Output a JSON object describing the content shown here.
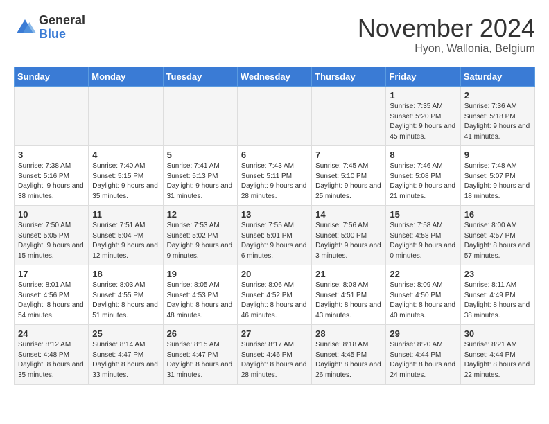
{
  "logo": {
    "general": "General",
    "blue": "Blue"
  },
  "title": "November 2024",
  "location": "Hyon, Wallonia, Belgium",
  "weekdays": [
    "Sunday",
    "Monday",
    "Tuesday",
    "Wednesday",
    "Thursday",
    "Friday",
    "Saturday"
  ],
  "weeks": [
    [
      {
        "day": "",
        "sunrise": "",
        "sunset": "",
        "daylight": ""
      },
      {
        "day": "",
        "sunrise": "",
        "sunset": "",
        "daylight": ""
      },
      {
        "day": "",
        "sunrise": "",
        "sunset": "",
        "daylight": ""
      },
      {
        "day": "",
        "sunrise": "",
        "sunset": "",
        "daylight": ""
      },
      {
        "day": "",
        "sunrise": "",
        "sunset": "",
        "daylight": ""
      },
      {
        "day": "1",
        "sunrise": "Sunrise: 7:35 AM",
        "sunset": "Sunset: 5:20 PM",
        "daylight": "Daylight: 9 hours and 45 minutes."
      },
      {
        "day": "2",
        "sunrise": "Sunrise: 7:36 AM",
        "sunset": "Sunset: 5:18 PM",
        "daylight": "Daylight: 9 hours and 41 minutes."
      }
    ],
    [
      {
        "day": "3",
        "sunrise": "Sunrise: 7:38 AM",
        "sunset": "Sunset: 5:16 PM",
        "daylight": "Daylight: 9 hours and 38 minutes."
      },
      {
        "day": "4",
        "sunrise": "Sunrise: 7:40 AM",
        "sunset": "Sunset: 5:15 PM",
        "daylight": "Daylight: 9 hours and 35 minutes."
      },
      {
        "day": "5",
        "sunrise": "Sunrise: 7:41 AM",
        "sunset": "Sunset: 5:13 PM",
        "daylight": "Daylight: 9 hours and 31 minutes."
      },
      {
        "day": "6",
        "sunrise": "Sunrise: 7:43 AM",
        "sunset": "Sunset: 5:11 PM",
        "daylight": "Daylight: 9 hours and 28 minutes."
      },
      {
        "day": "7",
        "sunrise": "Sunrise: 7:45 AM",
        "sunset": "Sunset: 5:10 PM",
        "daylight": "Daylight: 9 hours and 25 minutes."
      },
      {
        "day": "8",
        "sunrise": "Sunrise: 7:46 AM",
        "sunset": "Sunset: 5:08 PM",
        "daylight": "Daylight: 9 hours and 21 minutes."
      },
      {
        "day": "9",
        "sunrise": "Sunrise: 7:48 AM",
        "sunset": "Sunset: 5:07 PM",
        "daylight": "Daylight: 9 hours and 18 minutes."
      }
    ],
    [
      {
        "day": "10",
        "sunrise": "Sunrise: 7:50 AM",
        "sunset": "Sunset: 5:05 PM",
        "daylight": "Daylight: 9 hours and 15 minutes."
      },
      {
        "day": "11",
        "sunrise": "Sunrise: 7:51 AM",
        "sunset": "Sunset: 5:04 PM",
        "daylight": "Daylight: 9 hours and 12 minutes."
      },
      {
        "day": "12",
        "sunrise": "Sunrise: 7:53 AM",
        "sunset": "Sunset: 5:02 PM",
        "daylight": "Daylight: 9 hours and 9 minutes."
      },
      {
        "day": "13",
        "sunrise": "Sunrise: 7:55 AM",
        "sunset": "Sunset: 5:01 PM",
        "daylight": "Daylight: 9 hours and 6 minutes."
      },
      {
        "day": "14",
        "sunrise": "Sunrise: 7:56 AM",
        "sunset": "Sunset: 5:00 PM",
        "daylight": "Daylight: 9 hours and 3 minutes."
      },
      {
        "day": "15",
        "sunrise": "Sunrise: 7:58 AM",
        "sunset": "Sunset: 4:58 PM",
        "daylight": "Daylight: 9 hours and 0 minutes."
      },
      {
        "day": "16",
        "sunrise": "Sunrise: 8:00 AM",
        "sunset": "Sunset: 4:57 PM",
        "daylight": "Daylight: 8 hours and 57 minutes."
      }
    ],
    [
      {
        "day": "17",
        "sunrise": "Sunrise: 8:01 AM",
        "sunset": "Sunset: 4:56 PM",
        "daylight": "Daylight: 8 hours and 54 minutes."
      },
      {
        "day": "18",
        "sunrise": "Sunrise: 8:03 AM",
        "sunset": "Sunset: 4:55 PM",
        "daylight": "Daylight: 8 hours and 51 minutes."
      },
      {
        "day": "19",
        "sunrise": "Sunrise: 8:05 AM",
        "sunset": "Sunset: 4:53 PM",
        "daylight": "Daylight: 8 hours and 48 minutes."
      },
      {
        "day": "20",
        "sunrise": "Sunrise: 8:06 AM",
        "sunset": "Sunset: 4:52 PM",
        "daylight": "Daylight: 8 hours and 46 minutes."
      },
      {
        "day": "21",
        "sunrise": "Sunrise: 8:08 AM",
        "sunset": "Sunset: 4:51 PM",
        "daylight": "Daylight: 8 hours and 43 minutes."
      },
      {
        "day": "22",
        "sunrise": "Sunrise: 8:09 AM",
        "sunset": "Sunset: 4:50 PM",
        "daylight": "Daylight: 8 hours and 40 minutes."
      },
      {
        "day": "23",
        "sunrise": "Sunrise: 8:11 AM",
        "sunset": "Sunset: 4:49 PM",
        "daylight": "Daylight: 8 hours and 38 minutes."
      }
    ],
    [
      {
        "day": "24",
        "sunrise": "Sunrise: 8:12 AM",
        "sunset": "Sunset: 4:48 PM",
        "daylight": "Daylight: 8 hours and 35 minutes."
      },
      {
        "day": "25",
        "sunrise": "Sunrise: 8:14 AM",
        "sunset": "Sunset: 4:47 PM",
        "daylight": "Daylight: 8 hours and 33 minutes."
      },
      {
        "day": "26",
        "sunrise": "Sunrise: 8:15 AM",
        "sunset": "Sunset: 4:47 PM",
        "daylight": "Daylight: 8 hours and 31 minutes."
      },
      {
        "day": "27",
        "sunrise": "Sunrise: 8:17 AM",
        "sunset": "Sunset: 4:46 PM",
        "daylight": "Daylight: 8 hours and 28 minutes."
      },
      {
        "day": "28",
        "sunrise": "Sunrise: 8:18 AM",
        "sunset": "Sunset: 4:45 PM",
        "daylight": "Daylight: 8 hours and 26 minutes."
      },
      {
        "day": "29",
        "sunrise": "Sunrise: 8:20 AM",
        "sunset": "Sunset: 4:44 PM",
        "daylight": "Daylight: 8 hours and 24 minutes."
      },
      {
        "day": "30",
        "sunrise": "Sunrise: 8:21 AM",
        "sunset": "Sunset: 4:44 PM",
        "daylight": "Daylight: 8 hours and 22 minutes."
      }
    ]
  ]
}
